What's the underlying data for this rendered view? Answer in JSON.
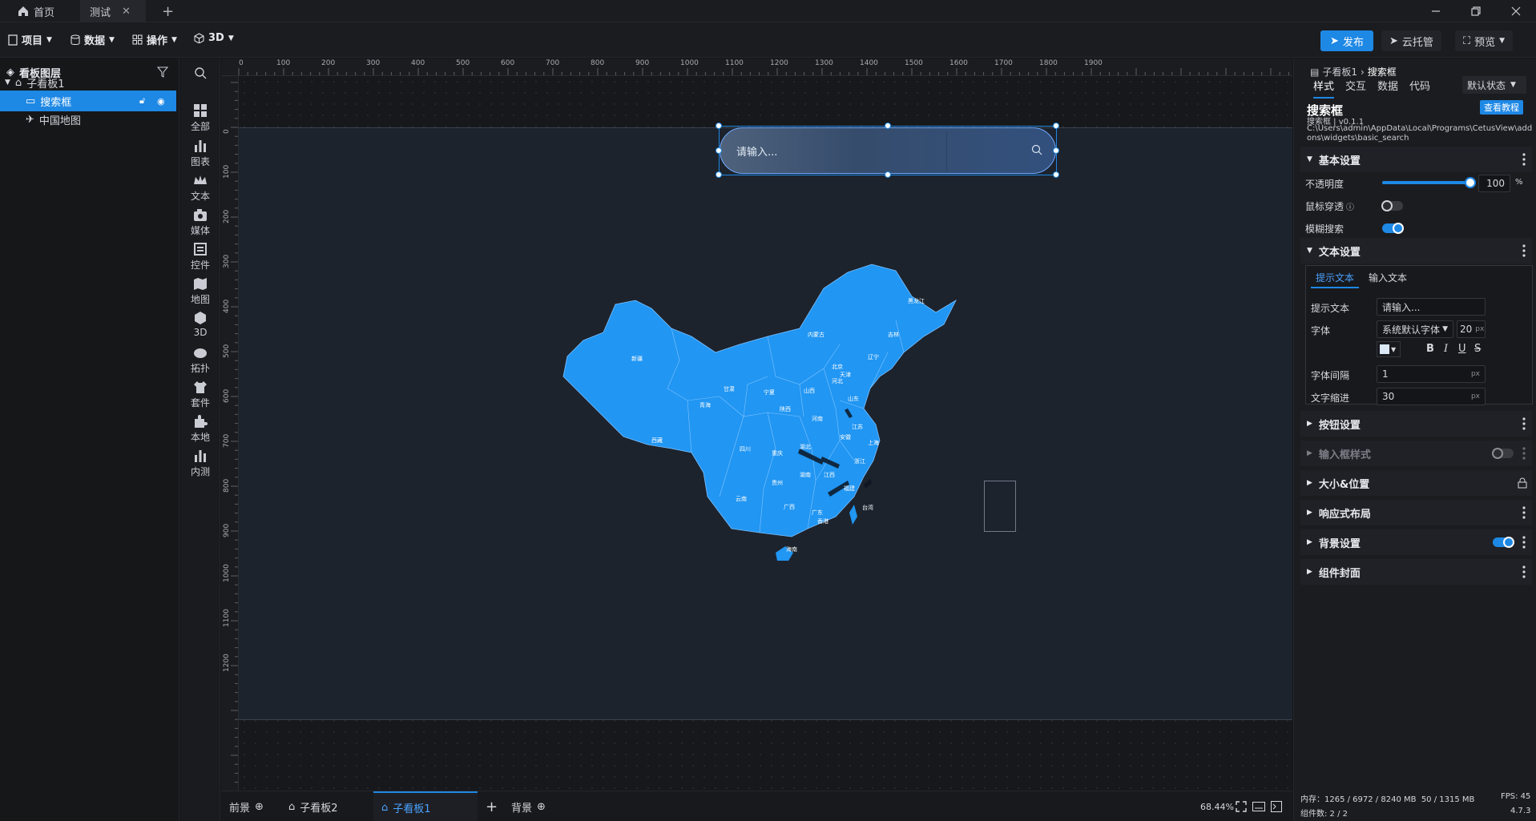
{
  "tabs": [
    {
      "label": "首页"
    },
    {
      "label": "测试"
    }
  ],
  "toolbar": {
    "menus": [
      "项目",
      "数据",
      "操作",
      "3D"
    ],
    "publish_label": "发布",
    "hosting_label": "云托管",
    "preview_label": "预览"
  },
  "layers": {
    "title": "看板图层",
    "items": [
      {
        "label": "子看板1"
      },
      {
        "label": "搜索框"
      },
      {
        "label": "中国地图"
      }
    ]
  },
  "palette": [
    "全部",
    "图表",
    "文本",
    "媒体",
    "控件",
    "地图",
    "3D",
    "拓扑",
    "套件",
    "本地",
    "内测"
  ],
  "ruler": {
    "h": [
      "0",
      "100",
      "200",
      "300",
      "400",
      "500",
      "600",
      "700",
      "800",
      "900",
      "1000",
      "1100",
      "1200",
      "1300",
      "1400",
      "1500",
      "1600",
      "1700",
      "1800",
      "1900"
    ],
    "v": [
      "0",
      "100",
      "200",
      "300",
      "400",
      "500",
      "600",
      "700",
      "800",
      "900",
      "1000",
      "1100",
      "1200"
    ]
  },
  "canvas": {
    "search_placeholder": "请输入...",
    "provinces": [
      "黑龙江",
      "吉林",
      "辽宁",
      "内蒙古",
      "北京",
      "天津",
      "河北",
      "山西",
      "山东",
      "新疆",
      "甘肃",
      "宁夏",
      "陕西",
      "河南",
      "江苏",
      "安徽",
      "上海",
      "青海",
      "西藏",
      "四川",
      "重庆",
      "湖北",
      "浙江",
      "湖南",
      "江西",
      "贵州",
      "福建",
      "云南",
      "广西",
      "广东",
      "台湾",
      "海南",
      "香港"
    ]
  },
  "bottom_tabs": {
    "front": "前景",
    "tab1": "子看板2",
    "tab2": "子看板1",
    "back": "背景",
    "zoom": "68.44%"
  },
  "props": {
    "breadcrumb_parent": "子看板1",
    "breadcrumb_current": "搜索框",
    "tabs": [
      "样式",
      "交互",
      "数据",
      "代码"
    ],
    "state": "默认状态",
    "widget_name": "搜索框",
    "version": "搜索框 | v0.1.1",
    "path": "C:\\Users\\admin\\AppData\\Local\\Programs\\CetusView\\addons\\widgets\\basic_search",
    "tutorial": "查看教程",
    "basic": {
      "title": "基本设置",
      "opacity_label": "不透明度",
      "opacity_value": "100",
      "opacity_level": 1.0,
      "opacity_unit": "%",
      "mouse_through": "鼠标穿透",
      "fuzzy_search": "模糊搜索"
    },
    "text": {
      "title": "文本设置",
      "subtabs": [
        "提示文本",
        "输入文本"
      ],
      "hint_label": "提示文本",
      "hint_value": "请输入...",
      "font_label": "字体",
      "font_value": "系统默认字体",
      "font_size": "20",
      "unit": "px",
      "spacing_label": "字体间隔",
      "spacing_value": "1",
      "indent_label": "文字缩进",
      "indent_value": "30"
    },
    "sections": [
      "按钮设置",
      "输入框样式",
      "大小&位置",
      "响应式布局",
      "背景设置",
      "组件封面"
    ]
  },
  "status": {
    "memory": "内存：1265 / 6972 / 8240 MB  50 / 1315 MB",
    "fps": "FPS: 45",
    "count": "组件数: 2 / 2",
    "version": "4.7.3"
  },
  "colors": {
    "accent": "#1e88e5",
    "map_fill": "#2196f3",
    "board": "#1c232d"
  }
}
